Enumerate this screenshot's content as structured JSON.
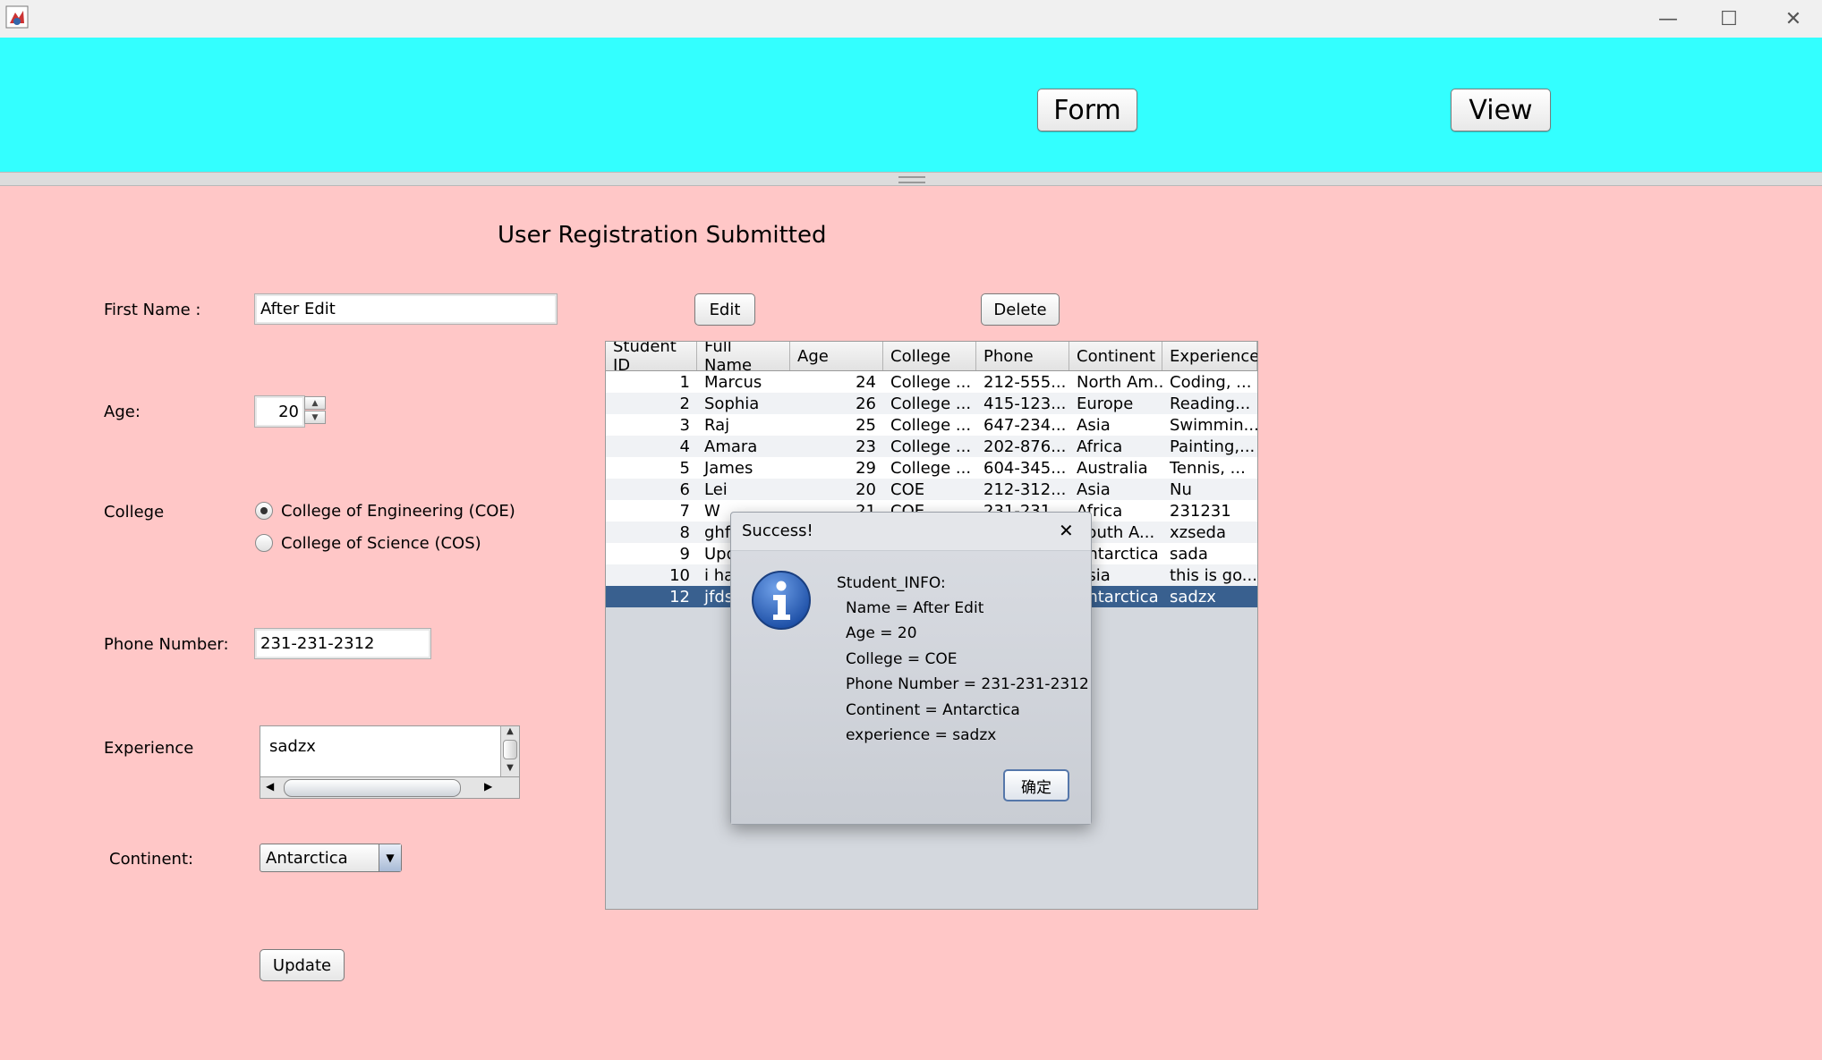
{
  "window": {
    "controls": {
      "minimize": "—",
      "maximize": "☐",
      "close": "✕"
    }
  },
  "top_nav": {
    "form_label": "Form",
    "view_label": "View"
  },
  "page": {
    "heading": "User Registration Submitted"
  },
  "form": {
    "first_name_label": "First Name :",
    "first_name_value": "After Edit",
    "age_label": "Age:",
    "age_value": "20",
    "college_label": "College",
    "college_options": [
      "College of Engineering (COE)",
      "College of Science (COS)"
    ],
    "college_selected": 0,
    "phone_label": "Phone Number:",
    "phone_value": "231-231-2312",
    "experience_label": "Experience",
    "experience_value": "sadzx",
    "continent_label": "Continent:",
    "continent_value": "Antarctica",
    "update_label": "Update"
  },
  "table_actions": {
    "edit_label": "Edit",
    "delete_label": "Delete"
  },
  "table": {
    "columns": [
      "Student ID",
      "Full Name",
      "Age",
      "College",
      "Phone",
      "Continent",
      "Experience"
    ],
    "rows": [
      [
        "1",
        "Marcus",
        "24",
        "College ...",
        "212-555...",
        "North Am...",
        "Coding, ..."
      ],
      [
        "2",
        "Sophia",
        "26",
        "College ...",
        "415-123...",
        "Europe",
        "Reading..."
      ],
      [
        "3",
        "Raj",
        "25",
        "College ...",
        "647-234...",
        "Asia",
        "Swimmin..."
      ],
      [
        "4",
        "Amara",
        "23",
        "College ...",
        "202-876...",
        "Africa",
        "Painting,..."
      ],
      [
        "5",
        "James",
        "29",
        "College ...",
        "604-345...",
        "Australia",
        "Tennis, ..."
      ],
      [
        "6",
        "Lei",
        "20",
        " COE",
        "212-312...",
        "Asia",
        "Nu"
      ],
      [
        "7",
        "W",
        "21",
        " COE",
        "231-231...",
        "Africa",
        "231231"
      ],
      [
        "8",
        "ghfg",
        "",
        "",
        "",
        "South A...",
        "xzseda"
      ],
      [
        "9",
        "Upd",
        "",
        "",
        "",
        "Antarctica",
        "sada"
      ],
      [
        "10",
        "i ha",
        "",
        "",
        "",
        "Asia",
        "this is go..."
      ],
      [
        "12",
        "jfds",
        "",
        "",
        "",
        "Antarctica",
        "sadzx"
      ]
    ],
    "selected_row": 10
  },
  "dialog": {
    "title": "Success!",
    "close": "✕",
    "icon": "info-icon",
    "lines": [
      "Student_INFO:",
      "Name = After Edit",
      "Age = 20",
      "College =  COE",
      "Phone Number = 231-231-2312",
      "Continent = Antarctica",
      "experience = sadzx"
    ],
    "ok_label": "确定"
  },
  "colors": {
    "top_panel": "#33ffff",
    "content_bg": "#ffc7c7",
    "selected_row": "#39608f"
  }
}
